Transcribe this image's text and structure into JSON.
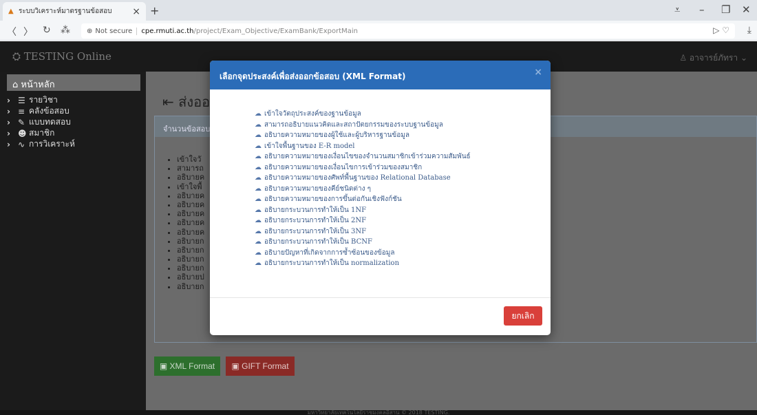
{
  "browser": {
    "tab_title": "ระบบวิเคราะห์มาตรฐานข้อสอบ",
    "url_not_secure": "Not secure",
    "url_host": "cpe.rmuti.ac.th",
    "url_path": "/project/Exam_Objective/ExamBank/ExportMain"
  },
  "app": {
    "brand": "TESTING Online",
    "user": "อาจารย์ภัทรา",
    "sidebar": {
      "home": "หน้าหลัก",
      "items": [
        {
          "label": "รายวิชา"
        },
        {
          "label": "คลังข้อสอบ"
        },
        {
          "label": "แบบทดสอบ"
        },
        {
          "label": "สมาชิก"
        },
        {
          "label": "การวิเคราะห์"
        }
      ]
    },
    "page_title": "ส่งออ",
    "panel_header": "จำนวนข้อสอบ",
    "panel_items": [
      "เข้าใจวั",
      "สามารถ",
      "อธิบายค",
      "เข้าใจพื้",
      "อธิบายค",
      "อธิบายค",
      "อธิบายค",
      "อธิบายค",
      "อธิบายค",
      "อธิบายก",
      "อธิบายก",
      "อธิบายก",
      "อธิบายก",
      "อธิบายป",
      "อธิบายก"
    ],
    "buttons": {
      "xml": "XML Format",
      "gift": "GIFT Format"
    },
    "footer": "มหาวิทยาลัยเทคโนโลยีราชมงคลอีสาน © 2018 TESTING."
  },
  "modal": {
    "title": "เลือกจุดประสงค์เพื่อส่งออกข้อสอบ (XML Format)",
    "close": "×",
    "objectives": [
      "เข้าใจวัตถุประสงค์ของฐานข้อมูล",
      "สามารถอธิบายแนวคิดและสถาปัตยกรรมของระบบฐานข้อมูล",
      "อธิบายความหมายของผู้ใช้และผู้บริหารฐานข้อมูล",
      "เข้าใจพื้นฐานของ E-R model",
      "อธิบายความหมายของเงื่อนไขของจำนวนสมาชิกเข้าร่วมความสัมพันธ์",
      "อธิบายความหมายของเงื่อนไขการเข้าร่วมของสมาชิก",
      "อธิบายความหมายของศัพท์พื้นฐานของ Relational Database",
      "อธิบายความหมายของคีย์ชนิดต่าง ๆ",
      "อธิบายความหมายของการขึ้นต่อกันเชิงฟังก์ชัน",
      "อธิบายกระบวนการทำให้เป็น 1NF",
      "อธิบายกระบวนการทำให้เป็น 2NF",
      "อธิบายกระบวนการทำให้เป็น 3NF",
      "อธิบายกระบวนการทำให้เป็น BCNF",
      "อธิบายปัญหาที่เกิดจากการซ้ำซ้อนของข้อมูล",
      "อธิบายกระบวนการทำให้เป็น normalization"
    ],
    "cancel": "ยกเลิก"
  }
}
